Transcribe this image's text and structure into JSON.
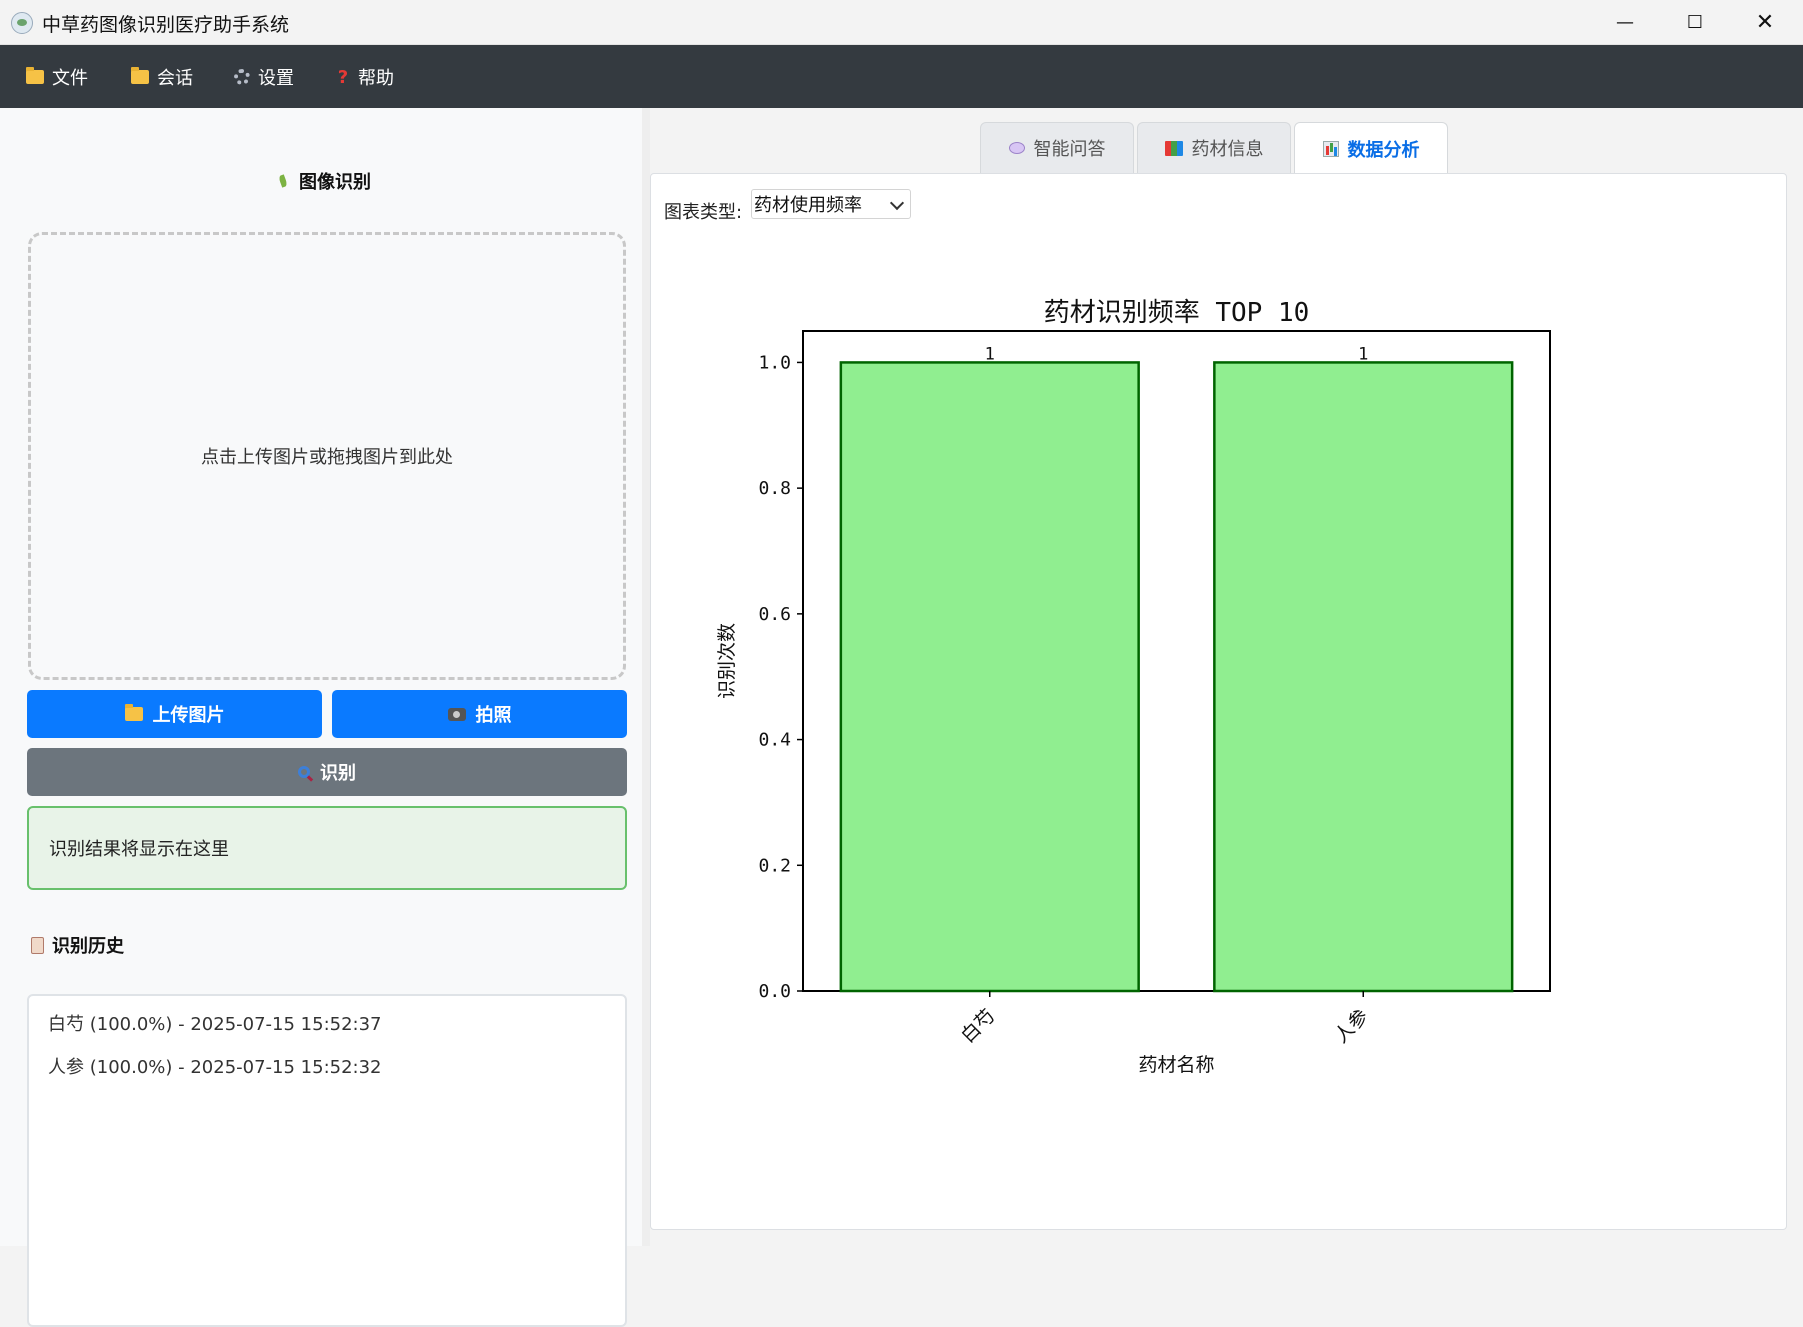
{
  "window": {
    "title": "中草药图像识别医疗助手系统",
    "minimize_label": "—",
    "maximize_label": "☐",
    "close_label": "✕"
  },
  "menu": {
    "file": "文件",
    "session": "会话",
    "settings": "设置",
    "help": "帮助"
  },
  "left": {
    "image_section_title": "图像识别",
    "dropzone_text": "点击上传图片或拖拽图片到此处",
    "upload_button": "上传图片",
    "camera_button": "拍照",
    "recognize_button": "识别",
    "result_placeholder": "识别结果将显示在这里",
    "history_title": "识别历史",
    "history": [
      "白芍 (100.0%) - 2025-07-15 15:52:37",
      "人参 (100.0%) - 2025-07-15 15:52:32"
    ]
  },
  "tabs": {
    "qa": "智能问答",
    "herb_info": "药材信息",
    "analysis": "数据分析",
    "active": "数据分析"
  },
  "analysis": {
    "chart_type_label": "图表类型:",
    "chart_type_value": "药材使用频率"
  },
  "chart_data": {
    "type": "bar",
    "title": "药材识别频率 TOP 10",
    "xlabel": "药材名称",
    "ylabel": "识别次数",
    "categories": [
      "白芍",
      "人参"
    ],
    "values": [
      1,
      1
    ],
    "data_labels": [
      "1",
      "1"
    ],
    "ylim": [
      0,
      1.05
    ],
    "yticks": [
      "0.0",
      "0.2",
      "0.4",
      "0.6",
      "0.8",
      "1.0"
    ],
    "bar_color": "#90ee90",
    "bar_edge_color": "#006400",
    "grid": false
  },
  "colors": {
    "menubar": "#343a40",
    "primary_button": "#0a7aff",
    "secondary_button": "#6c757d",
    "result_border": "#68c06c",
    "active_tab_text": "#0a6ee6"
  }
}
